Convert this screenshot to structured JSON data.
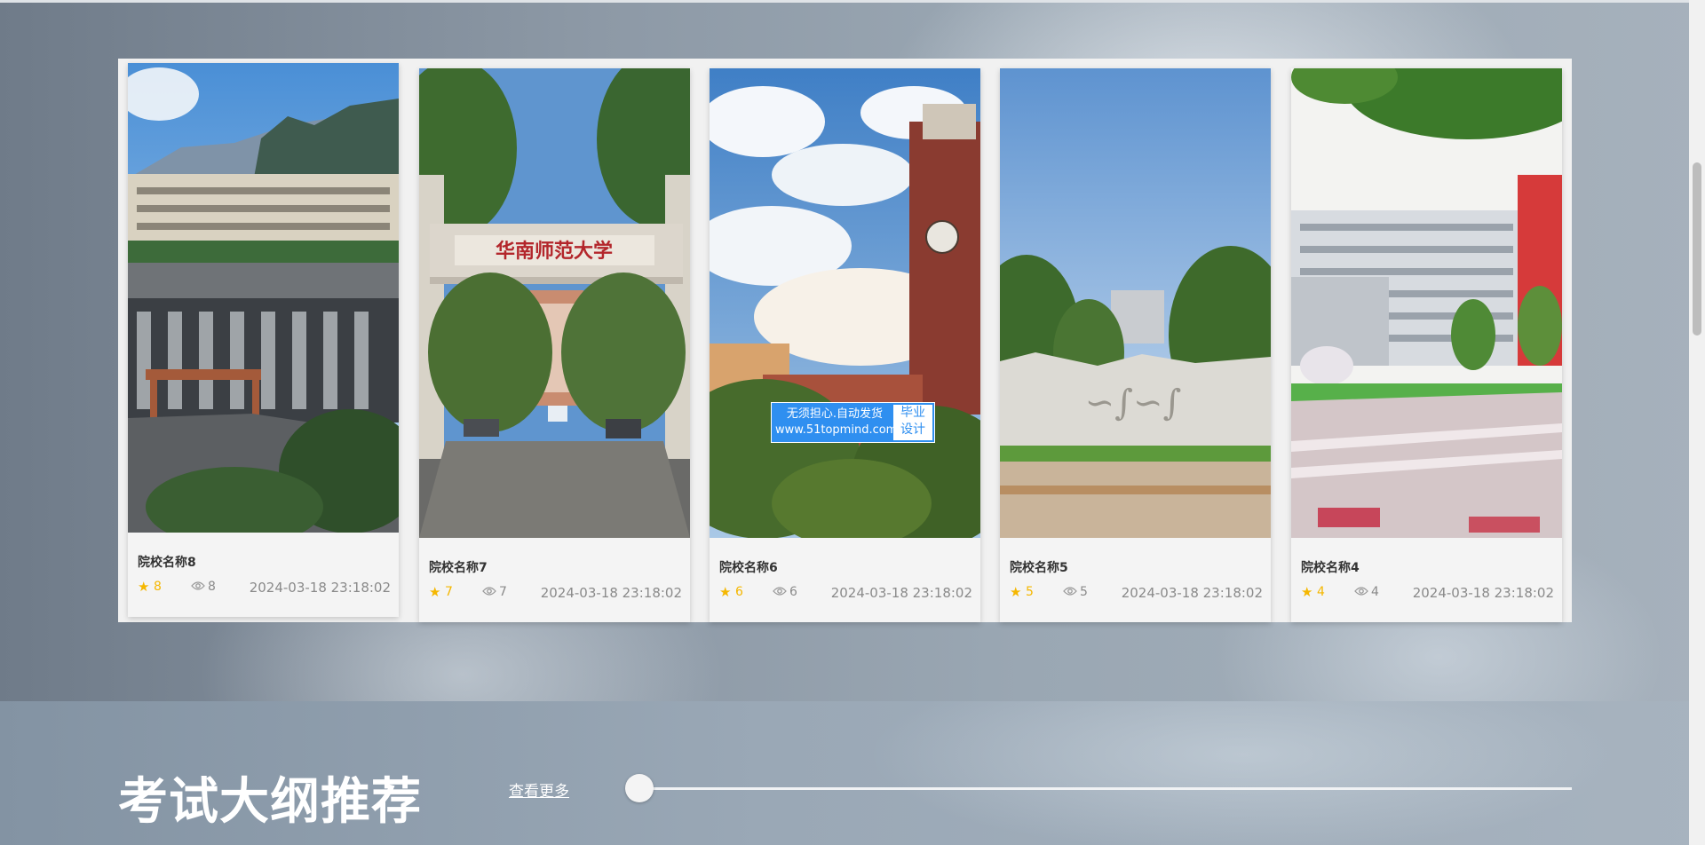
{
  "cards": [
    {
      "name": "院校名称8",
      "stars": "8",
      "views": "8",
      "date": "2024-03-18 23:18:02"
    },
    {
      "name": "院校名称7",
      "stars": "7",
      "views": "7",
      "date": "2024-03-18 23:18:02"
    },
    {
      "name": "院校名称6",
      "stars": "6",
      "views": "6",
      "date": "2024-03-18 23:18:02"
    },
    {
      "name": "院校名称5",
      "stars": "5",
      "views": "5",
      "date": "2024-03-18 23:18:02"
    },
    {
      "name": "院校名称4",
      "stars": "4",
      "views": "4",
      "date": "2024-03-18 23:18:02"
    }
  ],
  "watermark": {
    "line1": "无须担心.自动发货",
    "line2": "www.51topmind.com",
    "right1": "毕业",
    "right2": "设计"
  },
  "photo_sign": "华南师范大学",
  "section": {
    "title": "考试大纲推荐",
    "more_label": "查看更多"
  },
  "colors": {
    "star": "#f5b700",
    "badge": "#2f8ff0",
    "panel": "#f1f1f1"
  },
  "icons": {
    "star": "star-icon",
    "views": "eye-icon"
  }
}
